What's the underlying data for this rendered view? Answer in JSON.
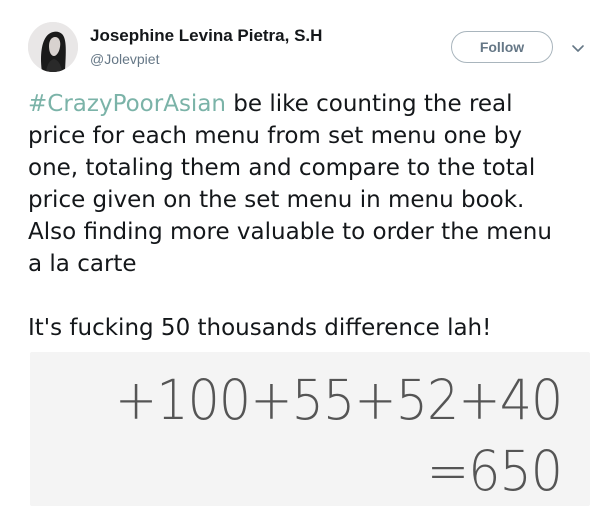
{
  "user": {
    "name": "Josephine Levina Pietra, S.H",
    "handle": "@Jolevpiet"
  },
  "follow_label": "Follow",
  "tweet": {
    "hashtag": "#CrazyPoorAsian",
    "line1_rest": " be like counting the real",
    "line2": "price for each menu from set menu one by",
    "line3": "one, totaling them and compare to the total",
    "line4": "price given on the set menu in menu book.",
    "line5": "Also finding more valuable to order the menu",
    "line6": "a la carte",
    "line7": "It's fucking 50 thousands difference lah!"
  },
  "media": {
    "calc_line1": "+100+55+52+40",
    "calc_line2": "=650"
  },
  "colors": {
    "hashtag": "#7bb3a8",
    "follow_border": "#a9b5bd",
    "handle": "#657786"
  }
}
